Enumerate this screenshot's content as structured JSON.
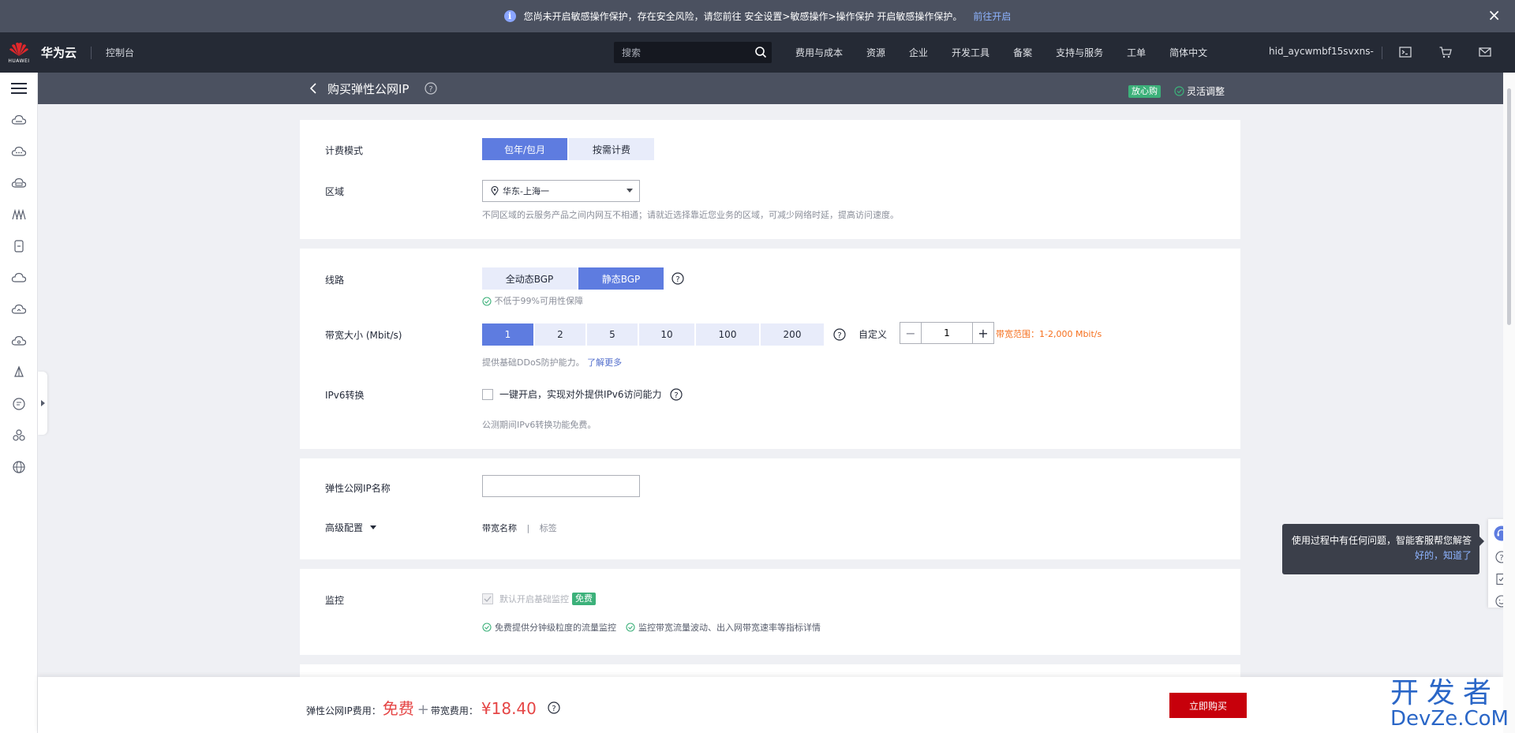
{
  "banner": {
    "text": "您尚未开启敏感操作保护，存在安全风险，请您前往 安全设置>敏感操作>操作保护 开启敏感操作保护。",
    "link": "前往开启",
    "info_glyph": "i",
    "close_glyph": "×"
  },
  "header": {
    "brand_text": "HUAWEI",
    "brand_name": "华为云",
    "console": "控制台",
    "search_placeholder": "搜索",
    "nav": [
      "费用与成本",
      "资源",
      "企业",
      "开发工具",
      "备案",
      "支持与服务",
      "工单",
      "简体中文"
    ],
    "user": "hid_aycwmbf15svxns-"
  },
  "title_bar": {
    "title": "购买弹性公网IP",
    "badge": "放心购",
    "flex_adjust": "灵活调整"
  },
  "billing": {
    "label": "计费模式",
    "options": [
      "包年/包月",
      "按需计费"
    ],
    "region_label": "区域",
    "region_value": "华东-上海一",
    "region_hint": "不同区域的云服务产品之间内网互不相通；请就近选择靠近您业务的区域，可减少网络时延，提高访问速度。"
  },
  "line": {
    "label": "线路",
    "options": [
      "全动态BGP",
      "静态BGP"
    ],
    "guarantee": "不低于99%可用性保障",
    "bandwidth_label": "带宽大小 (Mbit/s)",
    "bandwidth_options": [
      "1",
      "2",
      "5",
      "10",
      "100",
      "200"
    ],
    "custom_label": "自定义",
    "custom_value": "1",
    "range": "带宽范围：1-2,000 Mbit/s",
    "ddos_hint": "提供基础DDoS防护能力。",
    "learn_more": "了解更多",
    "ipv6_label": "IPv6转换",
    "ipv6_option": "一键开启，实现对外提供IPv6访问能力",
    "ipv6_hint": "公测期间IPv6转换功能免费。"
  },
  "name_section": {
    "label": "弹性公网IP名称",
    "value": "",
    "advanced_label": "高级配置",
    "advanced_items": [
      "带宽名称",
      "标签"
    ],
    "separator": "|"
  },
  "monitor": {
    "label": "监控",
    "default_text": "默认开启基础监控",
    "free_badge": "免费",
    "feature1": "免费提供分钟级粒度的流量监控",
    "feature2": "监控带宽流量波动、出入网带宽速率等指标详情"
  },
  "bottom": {
    "eip_fee_label": "弹性公网IP费用：",
    "eip_fee_value": "免费",
    "plus": "+",
    "bw_fee_label": "带宽费用：",
    "bw_fee_value": "¥18.40",
    "buy": "立即购买"
  },
  "tooltip": {
    "text": "使用过程中有任何问题，智能客服帮您解答",
    "ok": "好的，知道了"
  },
  "watermark": {
    "line1": "开发者",
    "line2": "DevZe.CoM"
  },
  "colors": {
    "primary": "#5e7ce0",
    "buy": "#c7000b",
    "price": "#e54545",
    "success": "#3cb17a",
    "warning": "#f66f1c"
  }
}
